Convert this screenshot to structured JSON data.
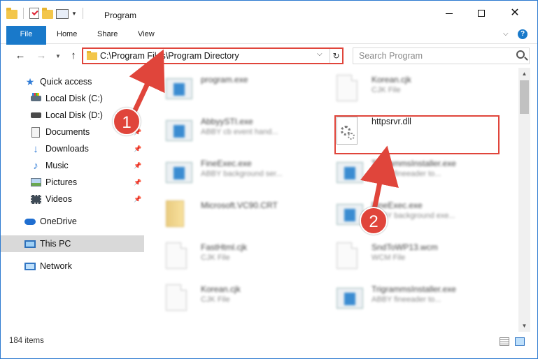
{
  "window": {
    "title": "Program"
  },
  "ribbon": {
    "tabs": [
      "File",
      "Home",
      "Share",
      "View"
    ]
  },
  "address": {
    "path": "C:\\Program Files\\Program Directory"
  },
  "search": {
    "placeholder": "Search Program"
  },
  "navpane": {
    "items": [
      {
        "label": "Quick access",
        "icon": "star-icon",
        "pinned": false
      },
      {
        "label": "Local Disk (C:)",
        "icon": "local-disk-icon",
        "pinned": false
      },
      {
        "label": "Local Disk (D:)",
        "icon": "local-disk-icon",
        "pinned": false
      },
      {
        "label": "Documents",
        "icon": "documents-icon",
        "pinned": true
      },
      {
        "label": "Downloads",
        "icon": "downloads-icon",
        "pinned": true
      },
      {
        "label": "Music",
        "icon": "music-icon",
        "pinned": true
      },
      {
        "label": "Pictures",
        "icon": "pictures-icon",
        "pinned": true
      },
      {
        "label": "Videos",
        "icon": "videos-icon",
        "pinned": true
      },
      {
        "label": "OneDrive",
        "icon": "onedrive-icon",
        "pinned": false
      },
      {
        "label": "This PC",
        "icon": "this-pc-icon",
        "pinned": false,
        "selected": true
      },
      {
        "label": "Network",
        "icon": "network-icon",
        "pinned": false
      }
    ]
  },
  "files": [
    {
      "name": "program.exe",
      "desc": "",
      "icon": "exe-icon"
    },
    {
      "name": "Korean.cjk",
      "desc": "CJK File",
      "icon": "file-icon"
    },
    {
      "name": "AbbyySTI.exe",
      "desc": "ABBY cb event hand...",
      "icon": "exe-icon"
    },
    {
      "name": "httpsrvr.dll",
      "desc": "",
      "icon": "dll-icon"
    },
    {
      "name": "FineExec.exe",
      "desc": "ABBY background ser...",
      "icon": "exe-icon"
    },
    {
      "name": "TrigrammsInstaller.exe",
      "desc": "ABBY fineeader to...",
      "icon": "exe-icon"
    },
    {
      "name": "Microsoft.VC90.CRT",
      "desc": "",
      "icon": "folder-icon"
    },
    {
      "name": "FineExec.exe",
      "desc": "ABBY background exe...",
      "icon": "exe-icon"
    },
    {
      "name": "FastHtml.cjk",
      "desc": "CJK File",
      "icon": "file-icon"
    },
    {
      "name": "SndToWP13.wcm",
      "desc": "WCM File",
      "icon": "file-icon"
    },
    {
      "name": "Korean.cjk",
      "desc": "CJK File",
      "icon": "file-icon"
    },
    {
      "name": "TrigrammsInstaller.exe",
      "desc": "ABBY fineeader to...",
      "icon": "exe-icon"
    }
  ],
  "status": {
    "item_count": "184 items"
  },
  "annotations": {
    "step1": "1",
    "step2": "2",
    "color": "#e0453b"
  }
}
